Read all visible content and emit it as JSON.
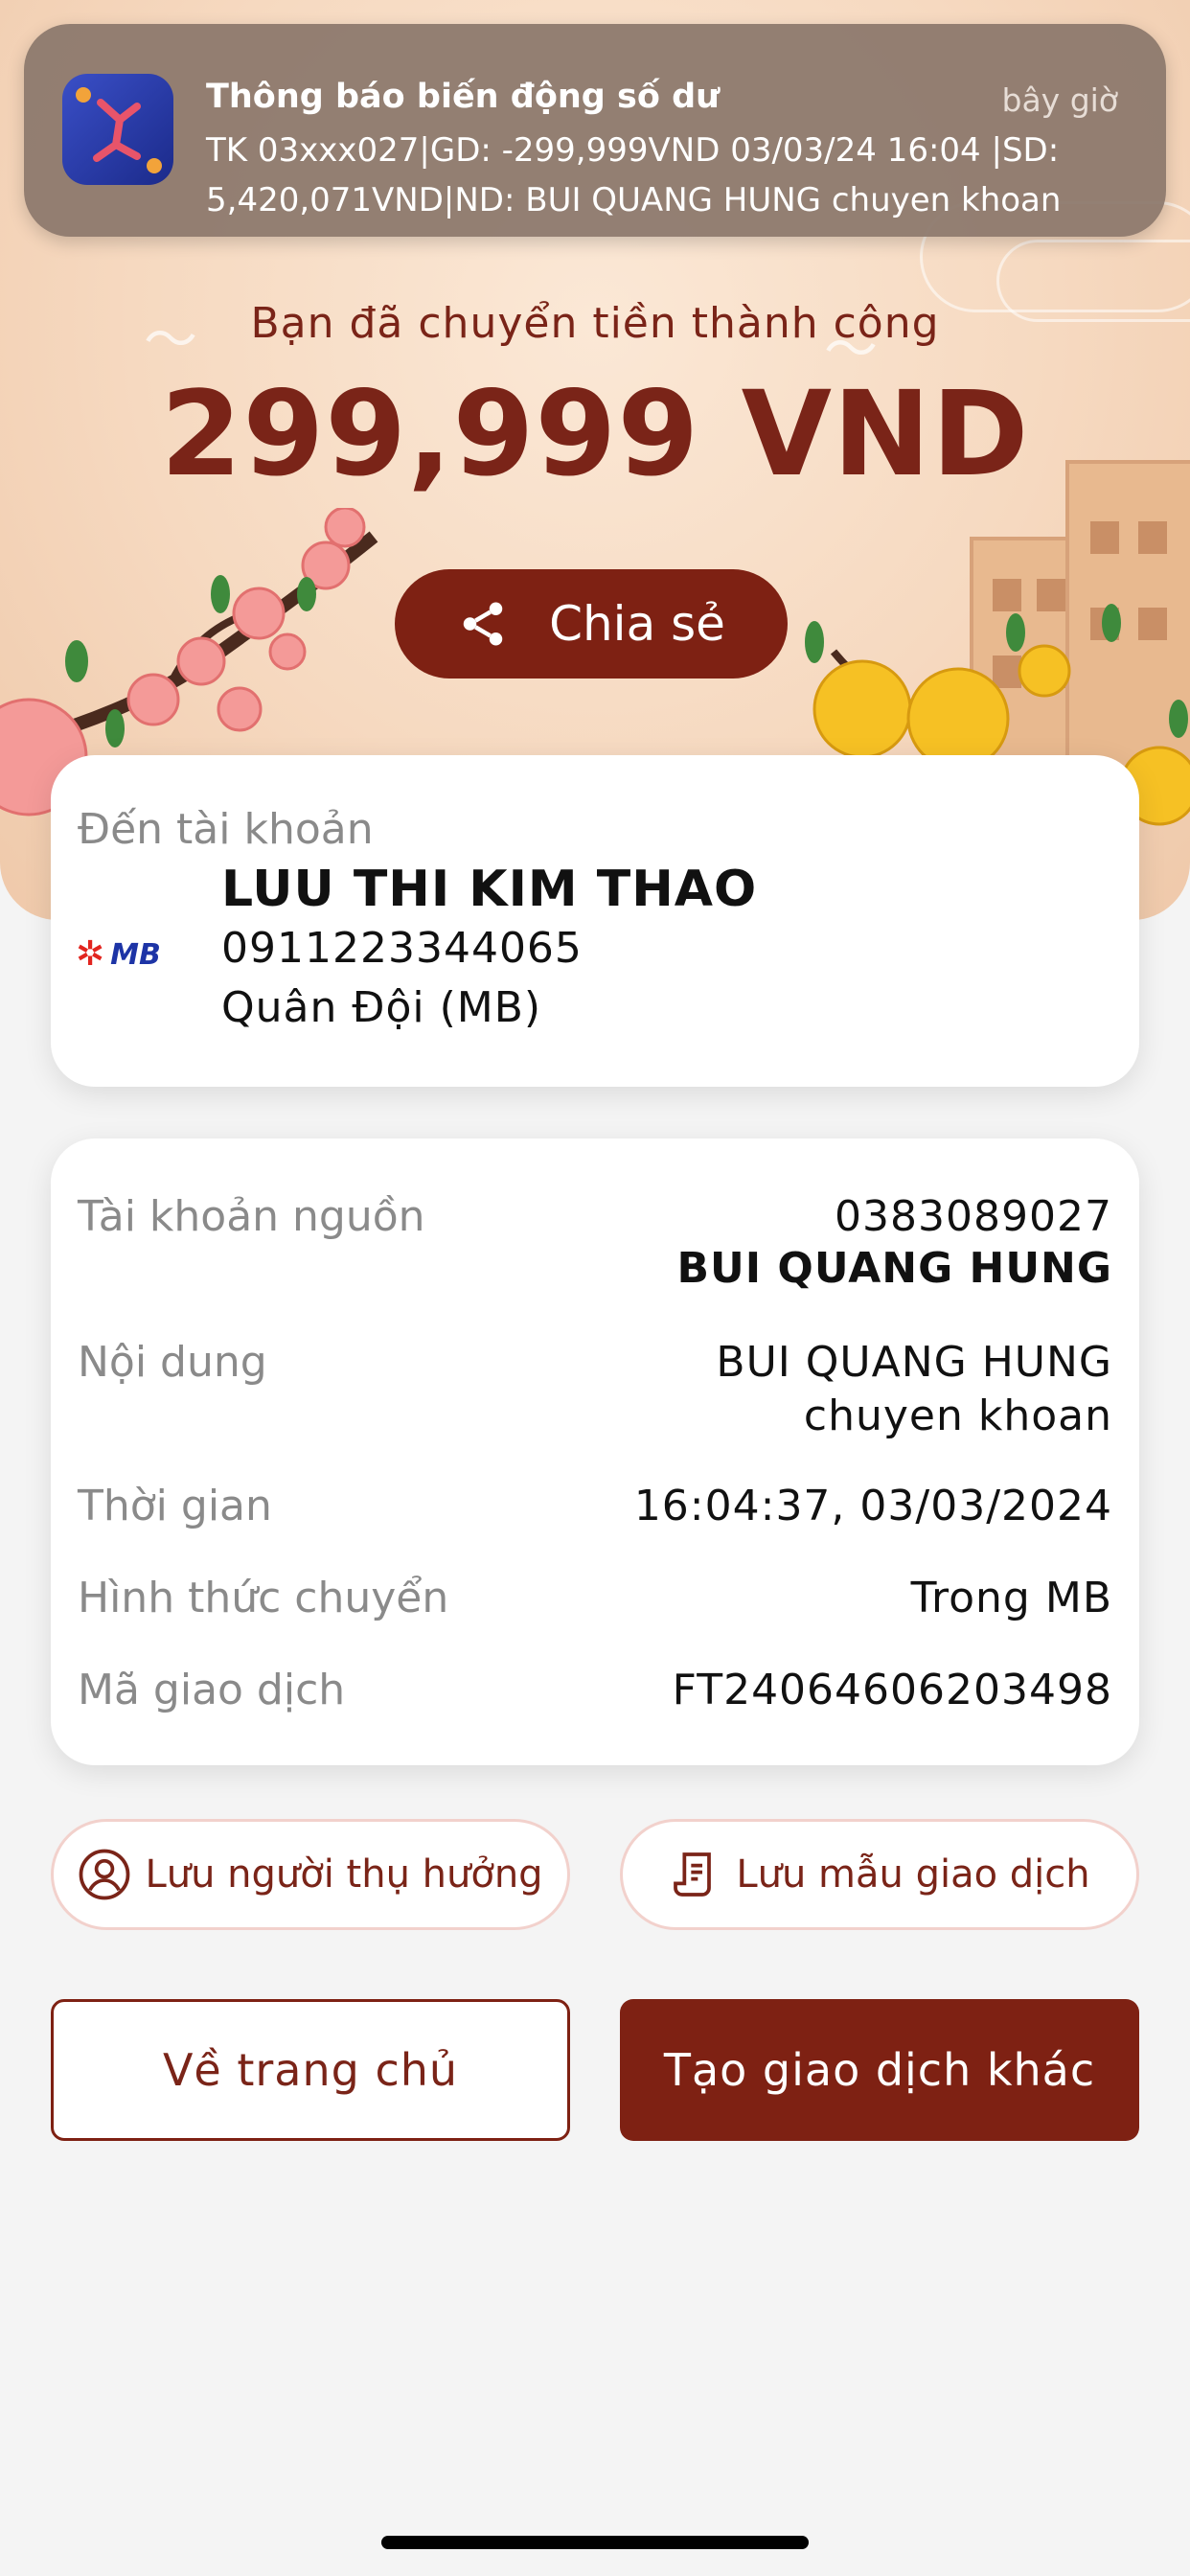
{
  "notification": {
    "title": "Thông báo biến động số dư",
    "time": "bây giờ",
    "body": "TK 03xxx027|GD: -299,999VND 03/03/24 16:04 |SD: 5,420,071VND|ND: BUI QUANG HUNG chuyen khoan"
  },
  "hero": {
    "success_text": "Bạn đã chuyển tiền thành công",
    "amount": "299,999 VND",
    "share_label": "Chia sẻ"
  },
  "destination": {
    "label": "Đến tài khoản",
    "bank_logo_text": "MB",
    "name": "LUU THI KIM THAO",
    "account": "0911223344065",
    "bank": "Quân Đội (MB)"
  },
  "details": {
    "source_label": "Tài khoản nguồn",
    "source_account": "0383089027",
    "source_name": "BUI QUANG HUNG",
    "content_label": "Nội dung",
    "content_line1": "BUI QUANG HUNG",
    "content_line2": "chuyen khoan",
    "time_label": "Thời gian",
    "time_value": "16:04:37, 03/03/2024",
    "method_label": "Hình thức chuyển",
    "method_value": "Trong MB",
    "txn_label": "Mã giao dịch",
    "txn_value": "FT24064606203498"
  },
  "actions": {
    "save_beneficiary": "Lưu người thụ hưởng",
    "save_template": "Lưu mẫu giao dịch",
    "home": "Về trang chủ",
    "new_transaction": "Tạo giao dịch khác"
  },
  "colors": {
    "brand": "#7e2113",
    "hero_bg": "#f6d9c0",
    "notification_bg": "#8a766a"
  }
}
